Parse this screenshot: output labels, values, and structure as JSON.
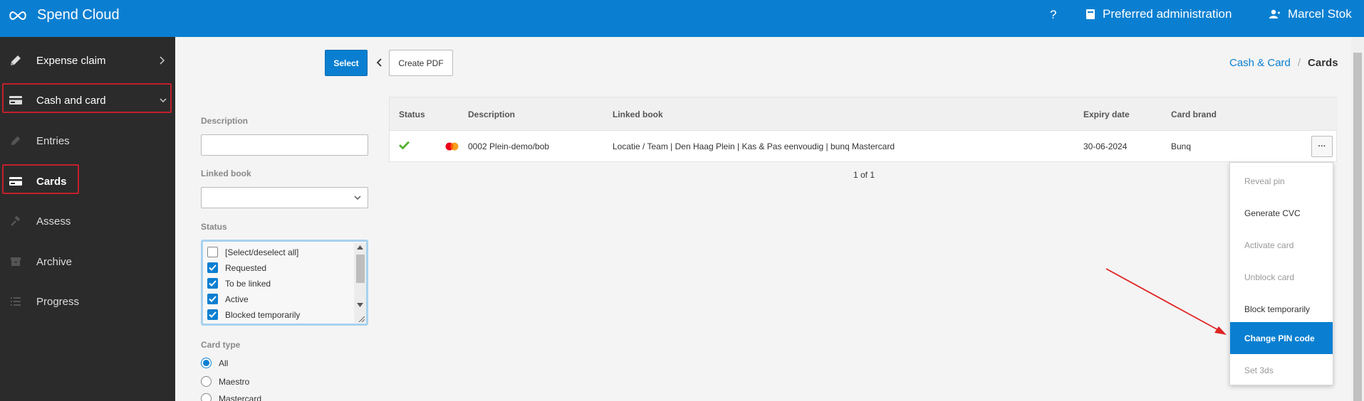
{
  "header": {
    "app_title": "Spend Cloud",
    "help": "?",
    "preferred_administration": "Preferred administration",
    "user_name": "Marcel Stok"
  },
  "sidebar": {
    "items": [
      {
        "label": "Expense claim",
        "icon": "pencil-icon"
      },
      {
        "label": "Cash and card",
        "icon": "card-icon"
      },
      {
        "label": "Entries",
        "icon": "pencil-icon"
      },
      {
        "label": "Cards",
        "icon": "card-icon"
      },
      {
        "label": "Assess",
        "icon": "gavel-icon"
      },
      {
        "label": "Archive",
        "icon": "archive-icon"
      },
      {
        "label": "Progress",
        "icon": "list-icon"
      }
    ]
  },
  "toolbar": {
    "select_label": "Select",
    "create_pdf_label": "Create PDF"
  },
  "breadcrumb": {
    "parent": "Cash & Card",
    "separator": "/",
    "current": "Cards"
  },
  "filters": {
    "description_label": "Description",
    "description_value": "",
    "linked_book_label": "Linked book",
    "linked_book_value": "",
    "status_label": "Status",
    "status_options": [
      {
        "label": "[Select/deselect all]",
        "checked": false
      },
      {
        "label": "Requested",
        "checked": true
      },
      {
        "label": "To be linked",
        "checked": true
      },
      {
        "label": "Active",
        "checked": true
      },
      {
        "label": "Blocked temporarily",
        "checked": true
      }
    ],
    "card_type_label": "Card type",
    "card_type_options": [
      {
        "label": "All",
        "selected": true
      },
      {
        "label": "Maestro",
        "selected": false
      },
      {
        "label": "Mastercard",
        "selected": false
      }
    ]
  },
  "table": {
    "columns": [
      "Status",
      "Description",
      "Linked book",
      "Expiry date",
      "Card brand"
    ],
    "rows": [
      {
        "status": "active",
        "description": "0002 Plein-demo/bob",
        "linked_book": "Locatie / Team | Den Haag Plein | Kas & Pas eenvoudig | bunq Mastercard",
        "expiry_date": "30-06-2024",
        "card_brand": "Bunq",
        "more_label": "···"
      }
    ],
    "pagination": "1 of 1"
  },
  "row_menu": {
    "items": [
      {
        "label": "Reveal pin",
        "state": "disabled"
      },
      {
        "label": "Generate CVC",
        "state": "enabled"
      },
      {
        "label": "Activate card",
        "state": "disabled"
      },
      {
        "label": "Unblock card",
        "state": "disabled"
      },
      {
        "label": "Block temporarily",
        "state": "enabled"
      },
      {
        "label": "Change PIN code",
        "state": "active"
      },
      {
        "label": "Set 3ds",
        "state": "disabled"
      }
    ]
  },
  "colors": {
    "primary": "#0a7fd1",
    "sidebar_bg": "#2b2b2b",
    "highlight_red": "#c3202c",
    "status_green": "#55b130"
  }
}
